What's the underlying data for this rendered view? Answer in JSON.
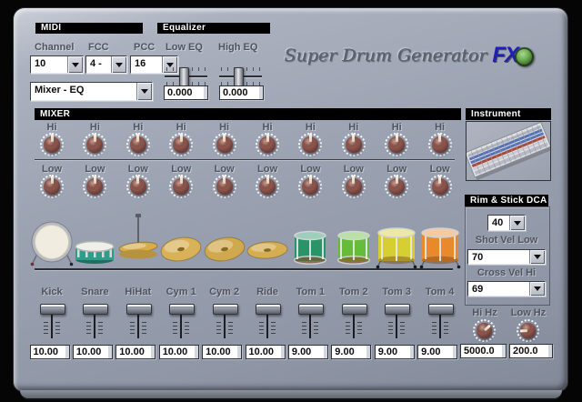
{
  "title": {
    "script_text": "Super Drum Generator",
    "fx_text": "FX"
  },
  "colors": {
    "panel": "#9aa1b0",
    "header_bg": "#000000",
    "header_text": "#ffffff",
    "knob_body": "#7d4a43",
    "led_green": "#6fae53",
    "logo_fx_blue": "#1f1fb8"
  },
  "midi": {
    "header": "MIDI",
    "channel_label": "Channel",
    "channel_value": "10",
    "fcc_label": "FCC",
    "fcc_value": "4 -",
    "pcc_label": "PCC",
    "pcc_value": "16",
    "preset_value": "Mixer - EQ"
  },
  "equalizer": {
    "header": "Equalizer",
    "low_label": "Low EQ",
    "high_label": "High EQ",
    "low_value": "0.000",
    "high_value": "0.000"
  },
  "mixer": {
    "header": "MIXER",
    "hi_label": "Hi",
    "low_label": "Low",
    "channels": [
      {
        "label": "Kick",
        "value": "10.00",
        "drum": "kick-drum",
        "color": "#f0ecdf"
      },
      {
        "label": "Snare",
        "value": "10.00",
        "drum": "snare-drum",
        "color": "#2d9e8a"
      },
      {
        "label": "HiHat",
        "value": "10.00",
        "drum": "hihat-cymbal",
        "color": "#d8ac4a"
      },
      {
        "label": "Cym 1",
        "value": "10.00",
        "drum": "crash-cymbal",
        "color": "#d9b258"
      },
      {
        "label": "Cym 2",
        "value": "10.00",
        "drum": "crash-cymbal",
        "color": "#d0a94e"
      },
      {
        "label": "Ride",
        "value": "10.00",
        "drum": "ride-cymbal",
        "color": "#d5ae52"
      },
      {
        "label": "Tom 1",
        "value": "9.00",
        "drum": "tom-drum",
        "color": "#2a9468"
      },
      {
        "label": "Tom 2",
        "value": "9.00",
        "drum": "tom-drum",
        "color": "#66bb3a"
      },
      {
        "label": "Tom 3",
        "value": "9.00",
        "drum": "floor-tom-drum",
        "color": "#d6ce33"
      },
      {
        "label": "Tom 4",
        "value": "9.00",
        "drum": "floor-tom-drum",
        "color": "#e8892b"
      }
    ]
  },
  "instrument": {
    "header": "Instrument"
  },
  "rim_stick_dca": {
    "header": "Rim & Stick DCA",
    "dca_value": "40",
    "shot_vel_label": "Shot Vel Low",
    "shot_vel_value": "70",
    "cross_vel_label": "Cross Vel Hi",
    "cross_vel_value": "69"
  },
  "output_filter": {
    "hi_hz_label": "Hi Hz",
    "hi_hz_value": "5000.0",
    "low_hz_label": "Low Hz",
    "low_hz_value": "200.0"
  }
}
